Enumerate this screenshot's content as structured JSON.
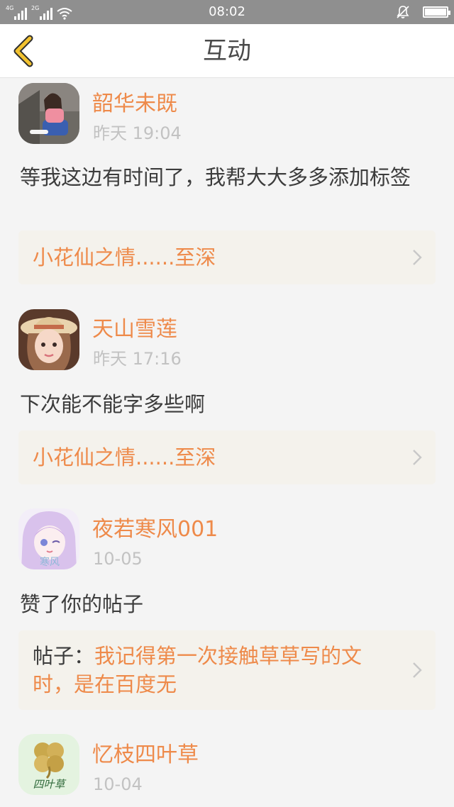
{
  "status_bar": {
    "network1": "4G",
    "network2": "2G",
    "time": "08:02",
    "icons": [
      "signal-icon",
      "signal-icon",
      "wifi-icon",
      "alarm-off-icon",
      "battery-icon"
    ]
  },
  "header": {
    "title": "互动",
    "back_icon": "chevron-left-icon"
  },
  "colors": {
    "accent": "#ee8a4a",
    "back_icon": "#f2c230",
    "time": "#c2c2c2",
    "text": "#3c3c3c",
    "ref_bg": "#f4f2ec"
  },
  "items": [
    {
      "name": "韶华未既",
      "time": "昨天 19:04",
      "content": "等我这边有时间了，我帮大大多多添加标签",
      "ref_prefix": "",
      "ref_title": "小花仙之情......至深"
    },
    {
      "name": "天山雪莲",
      "time": "昨天 17:16",
      "content": "下次能不能字多些啊",
      "ref_prefix": "",
      "ref_title": "小花仙之情......至深"
    },
    {
      "name": "夜若寒风001",
      "time": "10-05",
      "content": "赞了你的帖子",
      "ref_prefix": "帖子：",
      "ref_title": "我记得第一次接触草草写的文时，是在百度无"
    },
    {
      "name": "忆枝四叶草",
      "time": "10-04",
      "avatar_text": "四叶草"
    }
  ]
}
